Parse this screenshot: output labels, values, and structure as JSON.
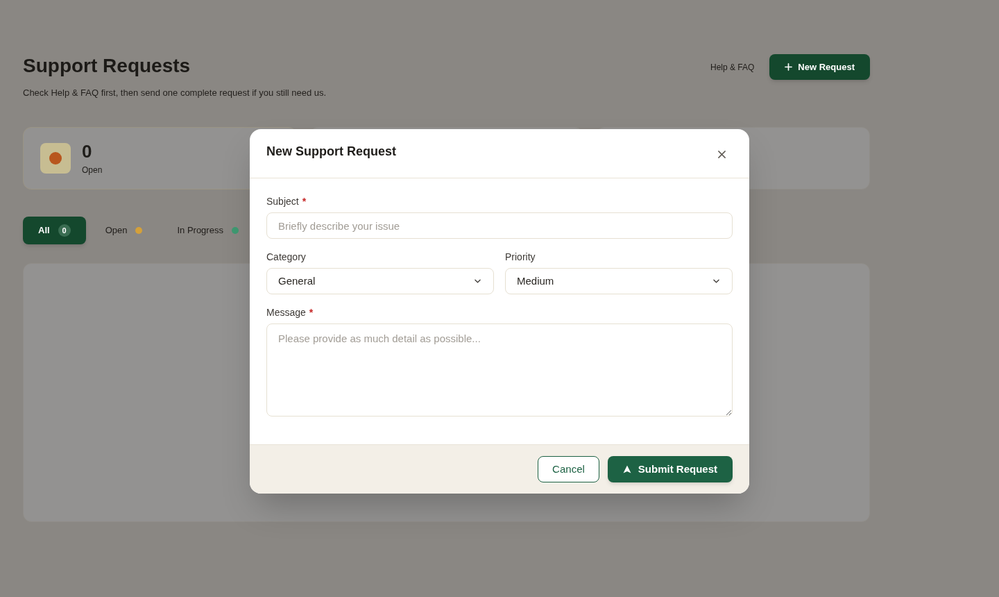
{
  "page": {
    "title": "Support Requests",
    "subtitle": "Check Help & FAQ first, then send one complete request if you still need us.",
    "help_link": "Help & FAQ",
    "new_request_button": "New Request"
  },
  "stats": [
    {
      "value": "0",
      "label": "Open",
      "color": "#b8561e"
    }
  ],
  "tabs": [
    {
      "label": "All",
      "count": "0",
      "selected": true
    },
    {
      "label": "Open",
      "color": "#d4a03a",
      "selected": false
    },
    {
      "label": "In Progress",
      "color": "#3f9a72",
      "selected": false
    }
  ],
  "dialog": {
    "title": "New Support Request",
    "fields": [
      {
        "kind": "text",
        "label": "Subject",
        "required_mark": "*",
        "placeholder": "Briefly describe your issue"
      },
      {
        "kind": "select",
        "label": "Category",
        "value": "General"
      },
      {
        "kind": "select",
        "label": "Priority",
        "value": "Medium"
      },
      {
        "kind": "textarea",
        "label": "Message",
        "required_mark": "*",
        "placeholder": "Please provide as much detail as possible..."
      }
    ],
    "buttons": [
      {
        "kind": "secondary",
        "label": "Cancel"
      },
      {
        "kind": "primary",
        "label": "Submit Request"
      }
    ]
  }
}
